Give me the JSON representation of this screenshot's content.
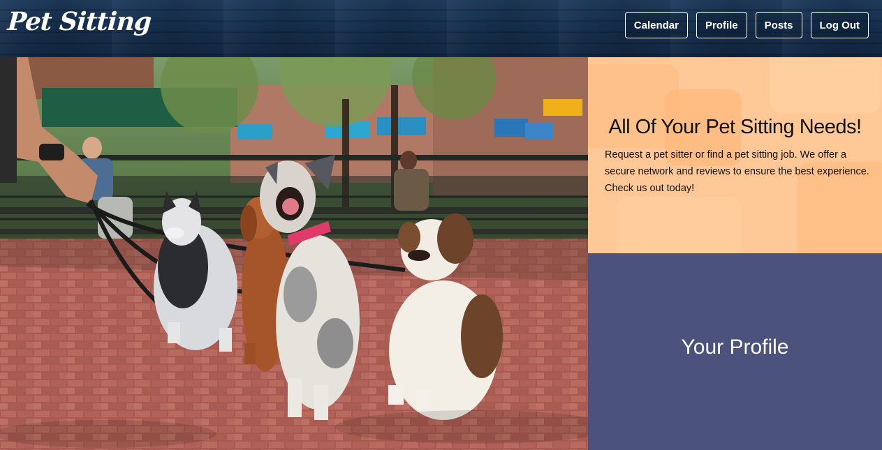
{
  "header": {
    "logo": "Pet Sitting",
    "nav": [
      {
        "label": "Calendar"
      },
      {
        "label": "Profile"
      },
      {
        "label": "Posts"
      },
      {
        "label": "Log Out"
      }
    ]
  },
  "promo": {
    "title": "All Of Your Pet Sitting Needs!",
    "body": "Request a pet sitter or find a pet sitting job. We offer a secure network and reviews to ensure the best experience. Check us out today!"
  },
  "profile_card": {
    "title": "Your Profile"
  },
  "colors": {
    "header": "#17304f",
    "promo_bg": "#ffc896",
    "profile_bg": "#4b527d"
  }
}
